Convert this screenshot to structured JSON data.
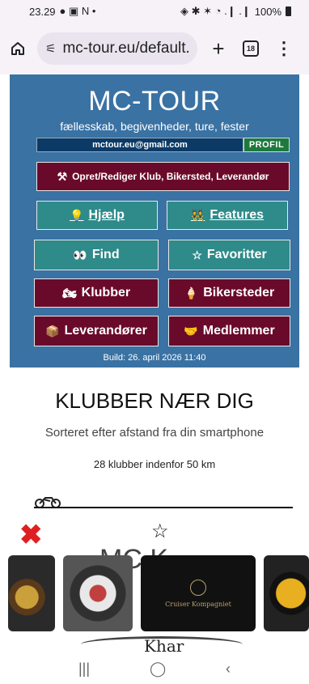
{
  "status_bar": {
    "time": "23.29",
    "left_icons": "● ▣ N •",
    "right_icons": "◈ ✱ ✶ ◔ .❙ .❙",
    "battery": "100%"
  },
  "browser": {
    "url": "mc-tour.eu/default.",
    "tab_count": "18",
    "plus": "+",
    "menu": "⋮"
  },
  "site": {
    "title": "MC-TOUR",
    "subtitle": "fællesskab, begivenheder, ture, fester",
    "email": "mctour.eu@gmail.com",
    "profil_label": "PROFIL",
    "build": "Build: 26. april 2026 11:40"
  },
  "buttons": {
    "opret": {
      "icon": "⚒",
      "label": "Opret/Rediger Klub, Bikersted, Leverandør"
    },
    "hjaelp": {
      "icon": "💡",
      "label": "Hjælp"
    },
    "features": {
      "icon": "👯",
      "label": "Features"
    },
    "find": {
      "icon": "👀",
      "label": "Find"
    },
    "favoritter": {
      "icon": "☆",
      "label": "Favoritter"
    },
    "klubber": {
      "icon": "🏍",
      "label": "Klubber"
    },
    "bikersteder": {
      "icon": "🍦",
      "label": "Bikersteder"
    },
    "leverandoerer": {
      "icon": "📦",
      "label": "Leverandører"
    },
    "medlemmer": {
      "icon": "🤝",
      "label": "Medlemmer"
    }
  },
  "section": {
    "title": "KLUBBER NÆR DIG",
    "subtitle": "Sorteret efter afstand fra din smartphone",
    "count_text": "28 klubber indenfor 50 km",
    "ghost_title": "MC K",
    "close_glyph": "✖",
    "star_glyph": "☆",
    "card_caption": "Cruiser Kompagniet",
    "bottom_fragment": "Khar"
  },
  "nav": {
    "recent": "|||",
    "home": "◯",
    "back": "‹"
  },
  "colors": {
    "header_bg": "#3a72a3",
    "maroon_button": "#6a0a2a",
    "teal_button": "#2f8a8a",
    "profil_green": "#1d7a3c",
    "close_red": "#e02020"
  }
}
